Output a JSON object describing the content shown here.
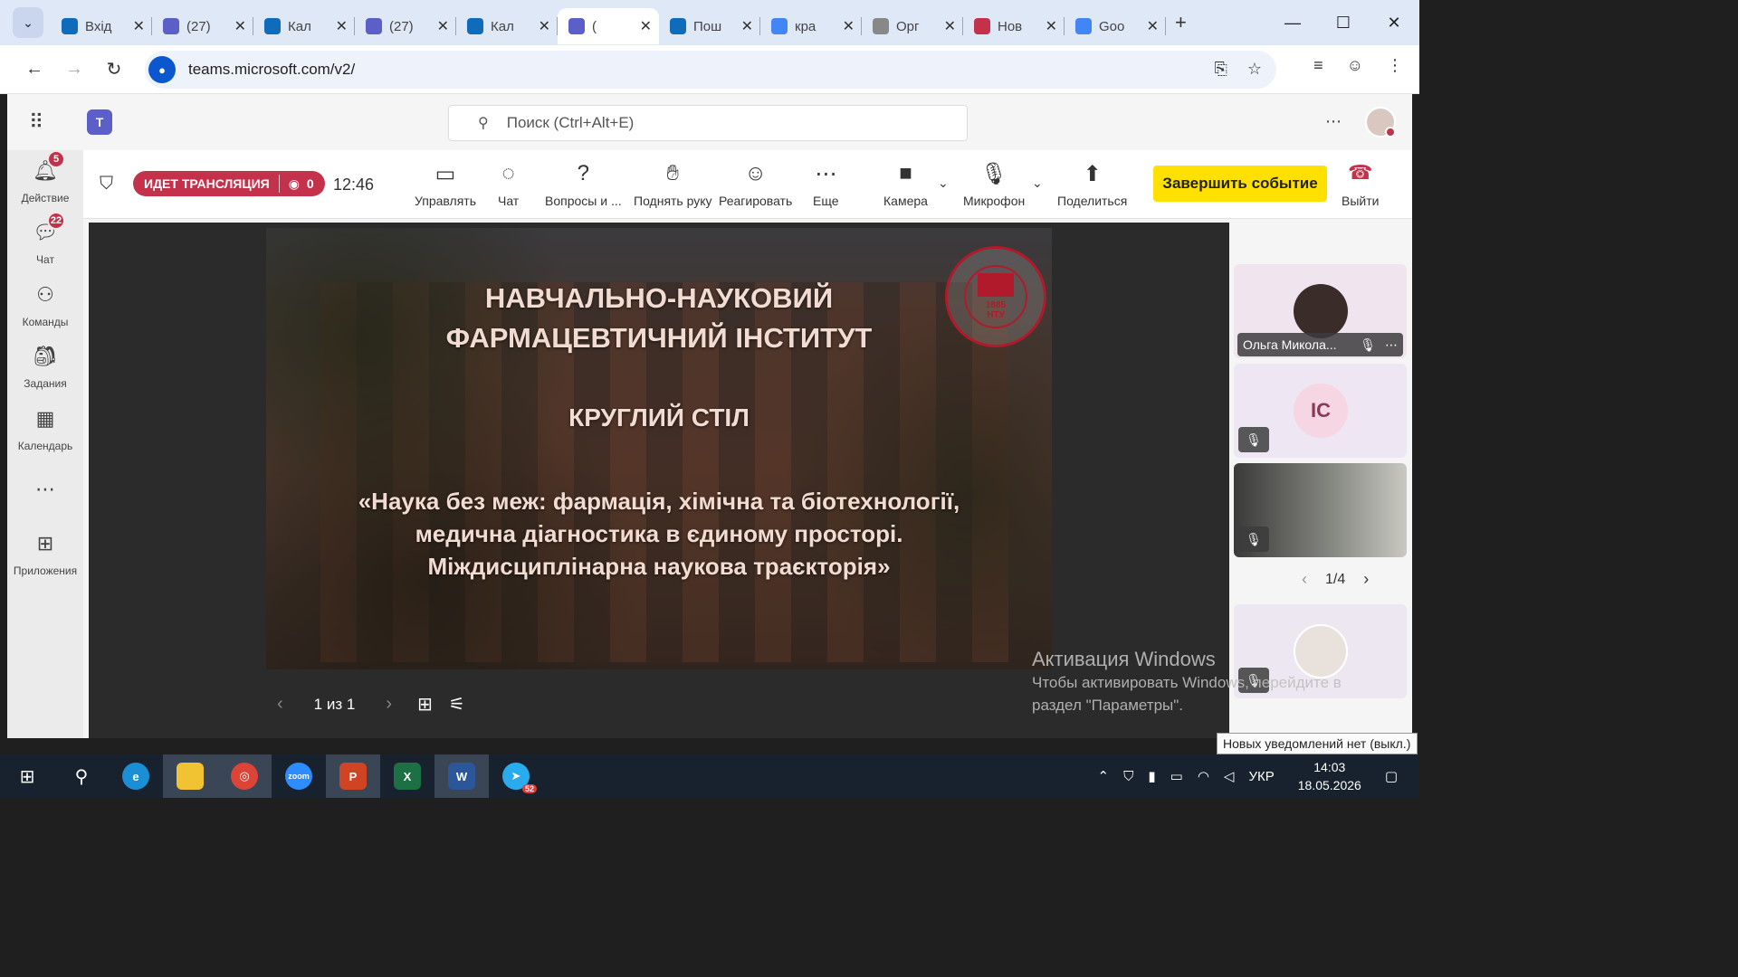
{
  "browser": {
    "tabs": [
      {
        "label": "Вхід",
        "color": "#0f6cbd",
        "active": false
      },
      {
        "label": "(27)",
        "color": "#5b5fc7",
        "active": false
      },
      {
        "label": "Кал",
        "color": "#0f6cbd",
        "active": false
      },
      {
        "label": "(27)",
        "color": "#5b5fc7",
        "active": false
      },
      {
        "label": "Кал",
        "color": "#0f6cbd",
        "active": false
      },
      {
        "label": "(",
        "color": "#5b5fc7",
        "active": true
      },
      {
        "label": "Пош",
        "color": "#0f6cbd",
        "active": false
      },
      {
        "label": "кра",
        "color": "#4285f4",
        "active": false
      },
      {
        "label": "Орг",
        "color": "#888888",
        "active": false
      },
      {
        "label": "Нов",
        "color": "#c4314b",
        "active": false
      },
      {
        "label": "Goo",
        "color": "#4285f4",
        "active": false
      }
    ],
    "url": "teams.microsoft.com/v2/"
  },
  "teams": {
    "search_placeholder": "Поиск (Ctrl+Alt+E)",
    "rail": [
      {
        "label": "Действие",
        "icon": "bell-icon",
        "badge": "5"
      },
      {
        "label": "Чат",
        "icon": "chat-icon",
        "badge": "22"
      },
      {
        "label": "Команды",
        "icon": "teams-icon",
        "badge": ""
      },
      {
        "label": "Задания",
        "icon": "assignments-icon",
        "badge": ""
      },
      {
        "label": "Календарь",
        "icon": "calendar-icon",
        "badge": ""
      },
      {
        "label": "",
        "icon": "more-icon",
        "badge": ""
      },
      {
        "label": "Приложения",
        "icon": "apps-icon",
        "badge": ""
      }
    ]
  },
  "meeting": {
    "live_label": "ИДЕТ ТРАНСЛЯЦИЯ",
    "viewer_count": "0",
    "timer": "12:46",
    "tools": {
      "manage": "Управлять",
      "chat": "Чат",
      "qa": "Вопросы и ...",
      "raise_hand": "Поднять руку",
      "react": "Реагировать",
      "more": "Еще",
      "camera": "Камера",
      "mic": "Микрофон",
      "share": "Поделиться"
    },
    "end_event": "Завершить событие",
    "leave": "Выйти"
  },
  "slide": {
    "title_line1": "НАВЧАЛЬНО-НАУКОВИЙ",
    "title_line2": "ФАРМАЦЕВТИЧНИЙ ІНСТИТУТ",
    "subtitle": "КРУГЛИЙ СТІЛ",
    "topic_line1": "«Наука без меж: фармація, хімічна та біотехнології,",
    "topic_line2": "медична діагностика в єдиному просторі.",
    "topic_line3": "Міждисциплінарна наукова траєкторія»",
    "seal_year": "1885",
    "seal_abbr": "НТУ",
    "pager": "1 из 1"
  },
  "participants": {
    "tiles": [
      {
        "name": "Ольга Микола...",
        "initials": ""
      },
      {
        "name": "",
        "initials": "IC"
      },
      {
        "name": "",
        "initials": ""
      },
      {
        "name": "",
        "initials": ""
      }
    ],
    "page": "1/4"
  },
  "watermark": {
    "title": "Активация Windows",
    "line1": "Чтобы активировать Windows, перейдите в",
    "line2": "раздел \"Параметры\"."
  },
  "notification": "Новых уведомлений нет (выкл.)",
  "taskbar": {
    "lang": "УКР",
    "time": "14:03",
    "date": "18.05.2026",
    "zoom_label": "zoom",
    "telegram_badge": "52"
  }
}
